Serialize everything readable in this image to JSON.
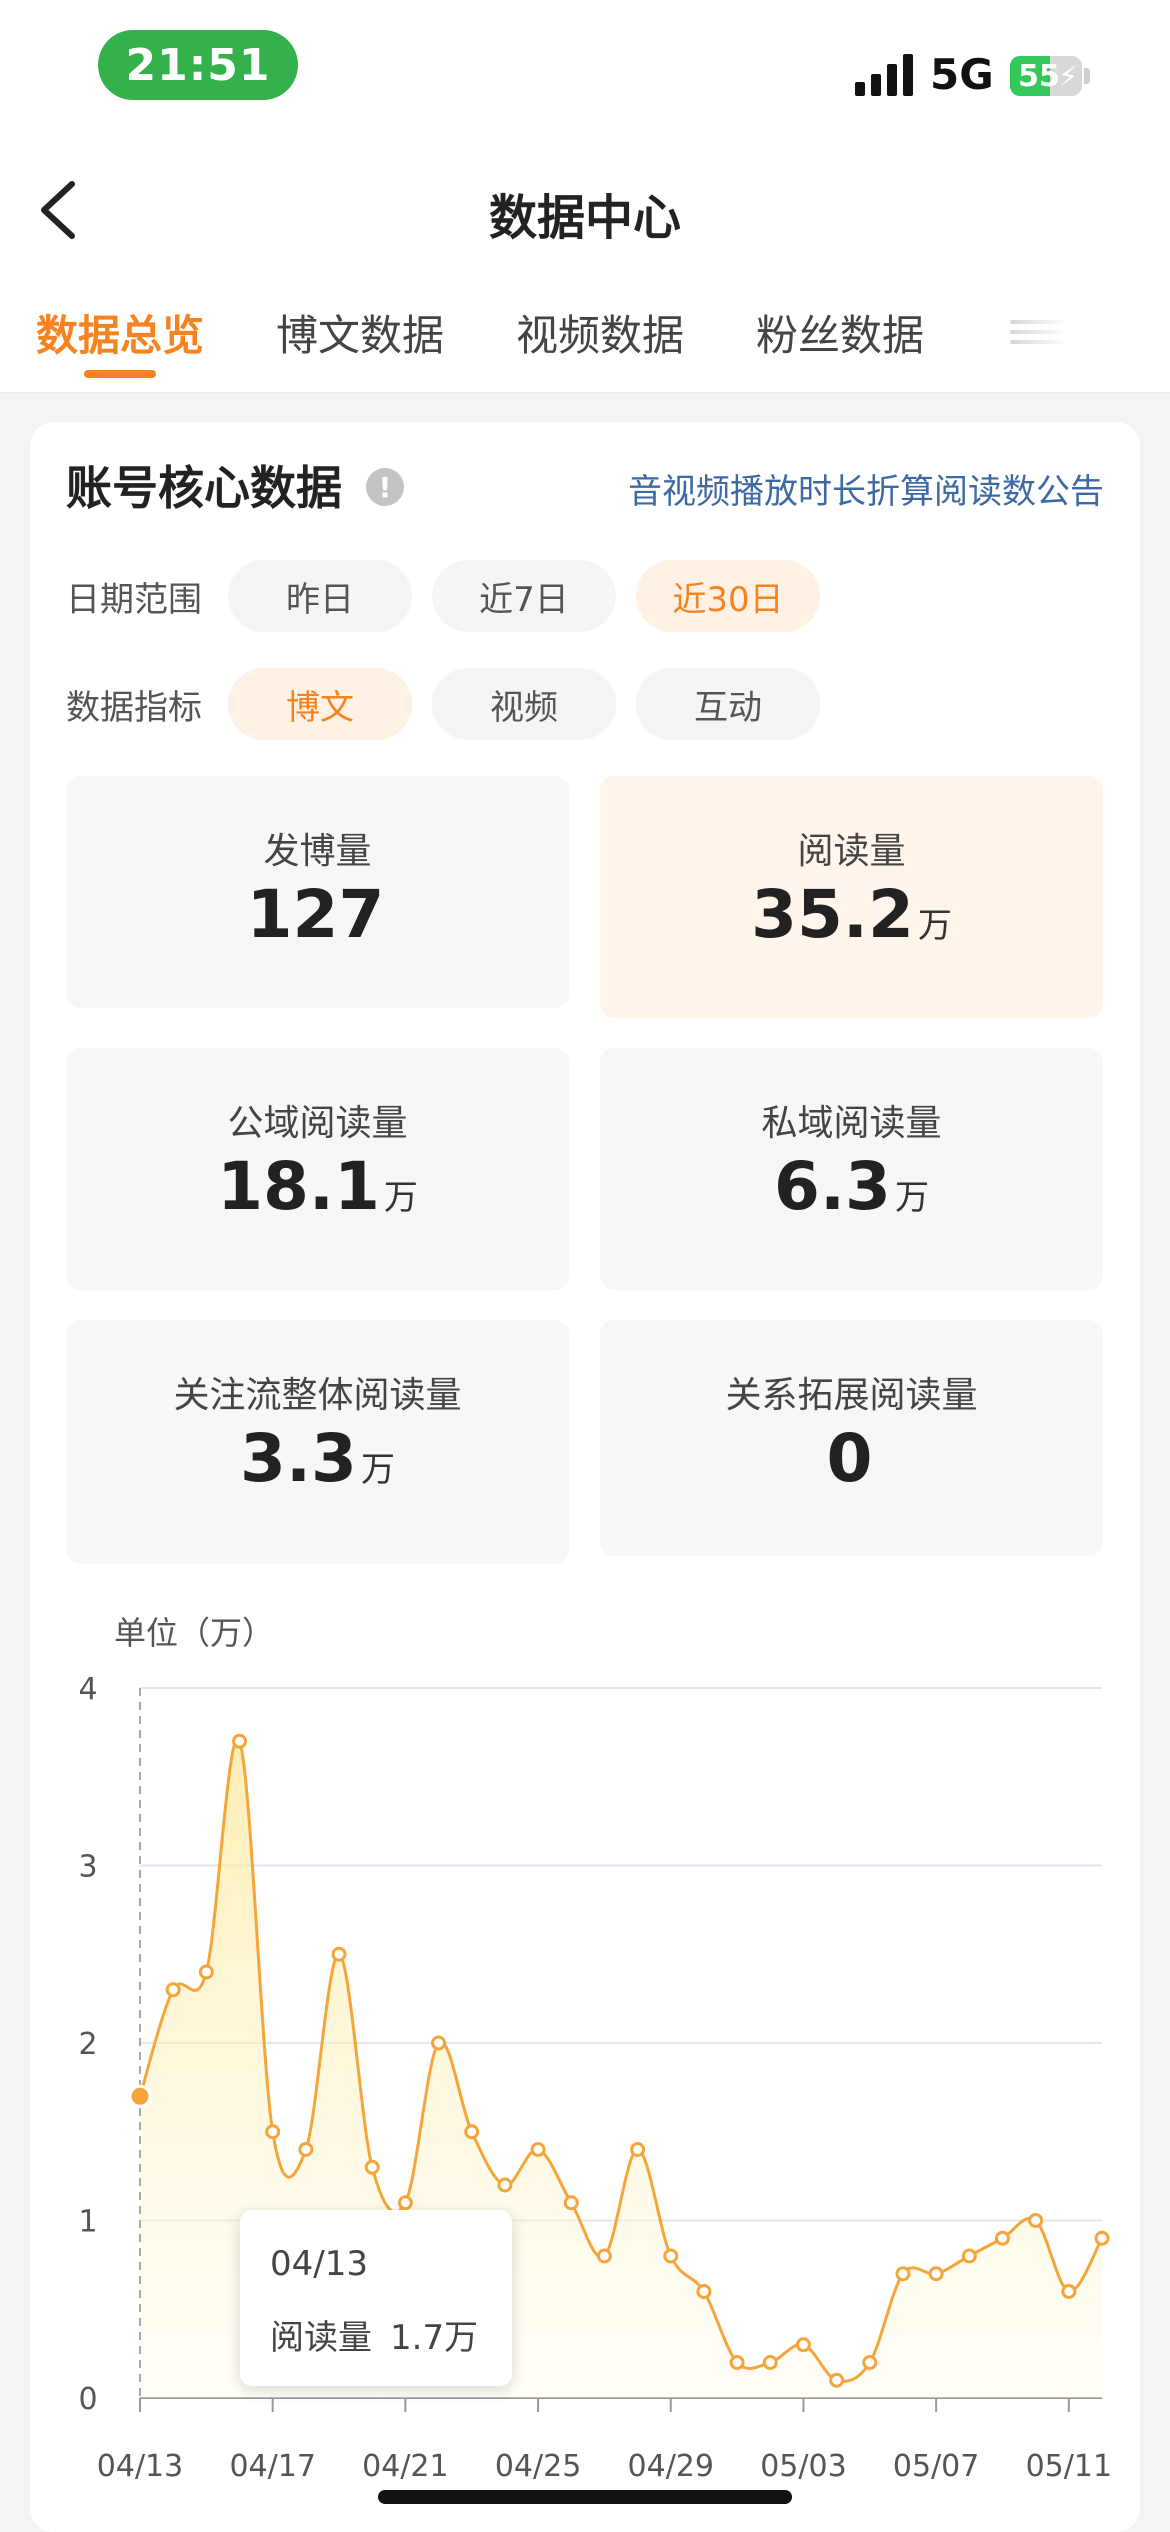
{
  "status_bar": {
    "time": "21:51",
    "network": "5G",
    "battery": "55",
    "battery_level": 0.55
  },
  "nav": {
    "title": "数据中心"
  },
  "tabs": [
    {
      "label": "数据总览",
      "active": true
    },
    {
      "label": "博文数据",
      "active": false
    },
    {
      "label": "视频数据",
      "active": false
    },
    {
      "label": "粉丝数据",
      "active": false
    }
  ],
  "core": {
    "title": "账号核心数据",
    "info_icon": "info-icon",
    "notice_link": "音视频播放时长折算阅读数公告",
    "date_range": {
      "label": "日期范围",
      "options": [
        "昨日",
        "近7日",
        "近30日"
      ],
      "selected": "近30日"
    },
    "metric": {
      "label": "数据指标",
      "options": [
        "博文",
        "视频",
        "互动"
      ],
      "selected": "博文"
    },
    "stats": [
      {
        "label": "发博量",
        "value": "127",
        "unit": ""
      },
      {
        "label": "阅读量",
        "value": "35.2",
        "unit": "万"
      },
      {
        "label": "公域阅读量",
        "value": "18.1",
        "unit": "万"
      },
      {
        "label": "私域阅读量",
        "value": "6.3",
        "unit": "万"
      },
      {
        "label": "关注流整体阅读量",
        "value": "3.3",
        "unit": "万"
      },
      {
        "label": "关系拓展阅读量",
        "value": "0",
        "unit": ""
      }
    ]
  },
  "chart_data": {
    "type": "area",
    "title": "",
    "ylabel": "单位（万）",
    "xlabel": "",
    "ylim": [
      0,
      4
    ],
    "yticks": [
      "0",
      "1",
      "2",
      "3",
      "4"
    ],
    "x": [
      "04/13",
      "04/14",
      "04/15",
      "04/16",
      "04/17",
      "04/18",
      "04/19",
      "04/20",
      "04/21",
      "04/22",
      "04/23",
      "04/24",
      "04/25",
      "04/26",
      "04/27",
      "04/28",
      "04/29",
      "04/30",
      "05/01",
      "05/02",
      "05/03",
      "05/04",
      "05/05",
      "05/06",
      "05/07",
      "05/08",
      "05/09",
      "05/10",
      "05/11",
      "05/12"
    ],
    "xticks": [
      "04/13",
      "04/17",
      "04/21",
      "04/25",
      "04/29",
      "05/03",
      "05/07",
      "05/11"
    ],
    "series": [
      {
        "values": [
          1.7,
          2.3,
          2.4,
          3.7,
          1.5,
          1.4,
          2.5,
          1.3,
          1.1,
          2.0,
          1.5,
          1.2,
          1.4,
          1.1,
          0.8,
          1.4,
          0.8,
          0.6,
          0.2,
          0.2,
          0.3,
          0.1,
          0.2,
          0.7,
          0.7,
          0.8,
          0.9,
          1.0,
          0.6,
          0.9
        ]
      }
    ],
    "line_color": "#f5a63a",
    "grid": true,
    "tooltip": {
      "date": "04/13",
      "label": "阅读量",
      "value": "1.7万"
    }
  }
}
